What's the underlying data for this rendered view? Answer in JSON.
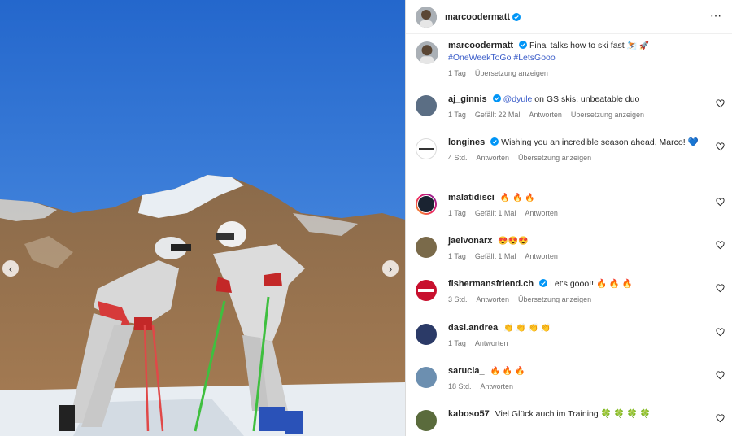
{
  "post": {
    "author": "marcoodermatt",
    "more_icon": "⋯",
    "nav_prev": "‹",
    "nav_next": "›"
  },
  "caption": {
    "user": "marcoodermatt",
    "text": "Final talks how to ski fast",
    "emoji": "⛷️ 🚀",
    "hashtags": "#OneWeekToGo #LetsGooo",
    "time": "1 Tag",
    "translate": "Übersetzung anzeigen"
  },
  "comments": [
    {
      "user": "aj_ginnis",
      "verified": true,
      "mention": "@dyule",
      "text": "on GS skis, unbeatable duo",
      "time": "1 Tag",
      "likes": "Gefällt 22 Mal",
      "reply": "Antworten",
      "translate": "Übersetzung anzeigen",
      "avatar_color": "#5b6e84"
    },
    {
      "user": "longines",
      "verified": true,
      "mention": "",
      "text": "Wishing you an incredible season ahead, Marco! 💙",
      "time": "4 Std.",
      "likes": "",
      "reply": "Antworten",
      "translate": "Übersetzung anzeigen",
      "avatar_color": "#ffffff"
    },
    {
      "user": "malatidisci",
      "verified": false,
      "mention": "",
      "text": "🔥 🔥 🔥",
      "time": "1 Tag",
      "likes": "Gefällt 1 Mal",
      "reply": "Antworten",
      "translate": "",
      "avatar_color": "#1a2331"
    },
    {
      "user": "jaelvonarx",
      "verified": false,
      "mention": "",
      "text": "😍😍😍",
      "time": "1 Tag",
      "likes": "Gefällt 1 Mal",
      "reply": "Antworten",
      "translate": "",
      "avatar_color": "#7a6a4a"
    },
    {
      "user": "fishermansfriend.ch",
      "verified": true,
      "mention": "",
      "text": "Let's gooo!! 🔥 🔥 🔥",
      "time": "3 Std.",
      "likes": "",
      "reply": "Antworten",
      "translate": "Übersetzung anzeigen",
      "avatar_color": "#c8102e"
    },
    {
      "user": "dasi.andrea",
      "verified": false,
      "mention": "",
      "text": "👏 👏 👏 👏",
      "time": "1 Tag",
      "likes": "",
      "reply": "Antworten",
      "translate": "",
      "avatar_color": "#2b3a67"
    },
    {
      "user": "sarucia_",
      "verified": false,
      "mention": "",
      "text": "🔥 🔥 🔥",
      "time": "18 Std.",
      "likes": "",
      "reply": "Antworten",
      "translate": "",
      "avatar_color": "#6c8fb0"
    },
    {
      "user": "kaboso57",
      "verified": false,
      "mention": "",
      "text": "Viel Glück auch im Training 🍀 🍀 🍀 🍀",
      "time": "",
      "likes": "",
      "reply": "",
      "translate": "",
      "avatar_color": "#5a6b3c"
    }
  ],
  "colors": {
    "verified": "#0095f6",
    "hashtag": "#3c5ec9",
    "meta": "#737373"
  }
}
